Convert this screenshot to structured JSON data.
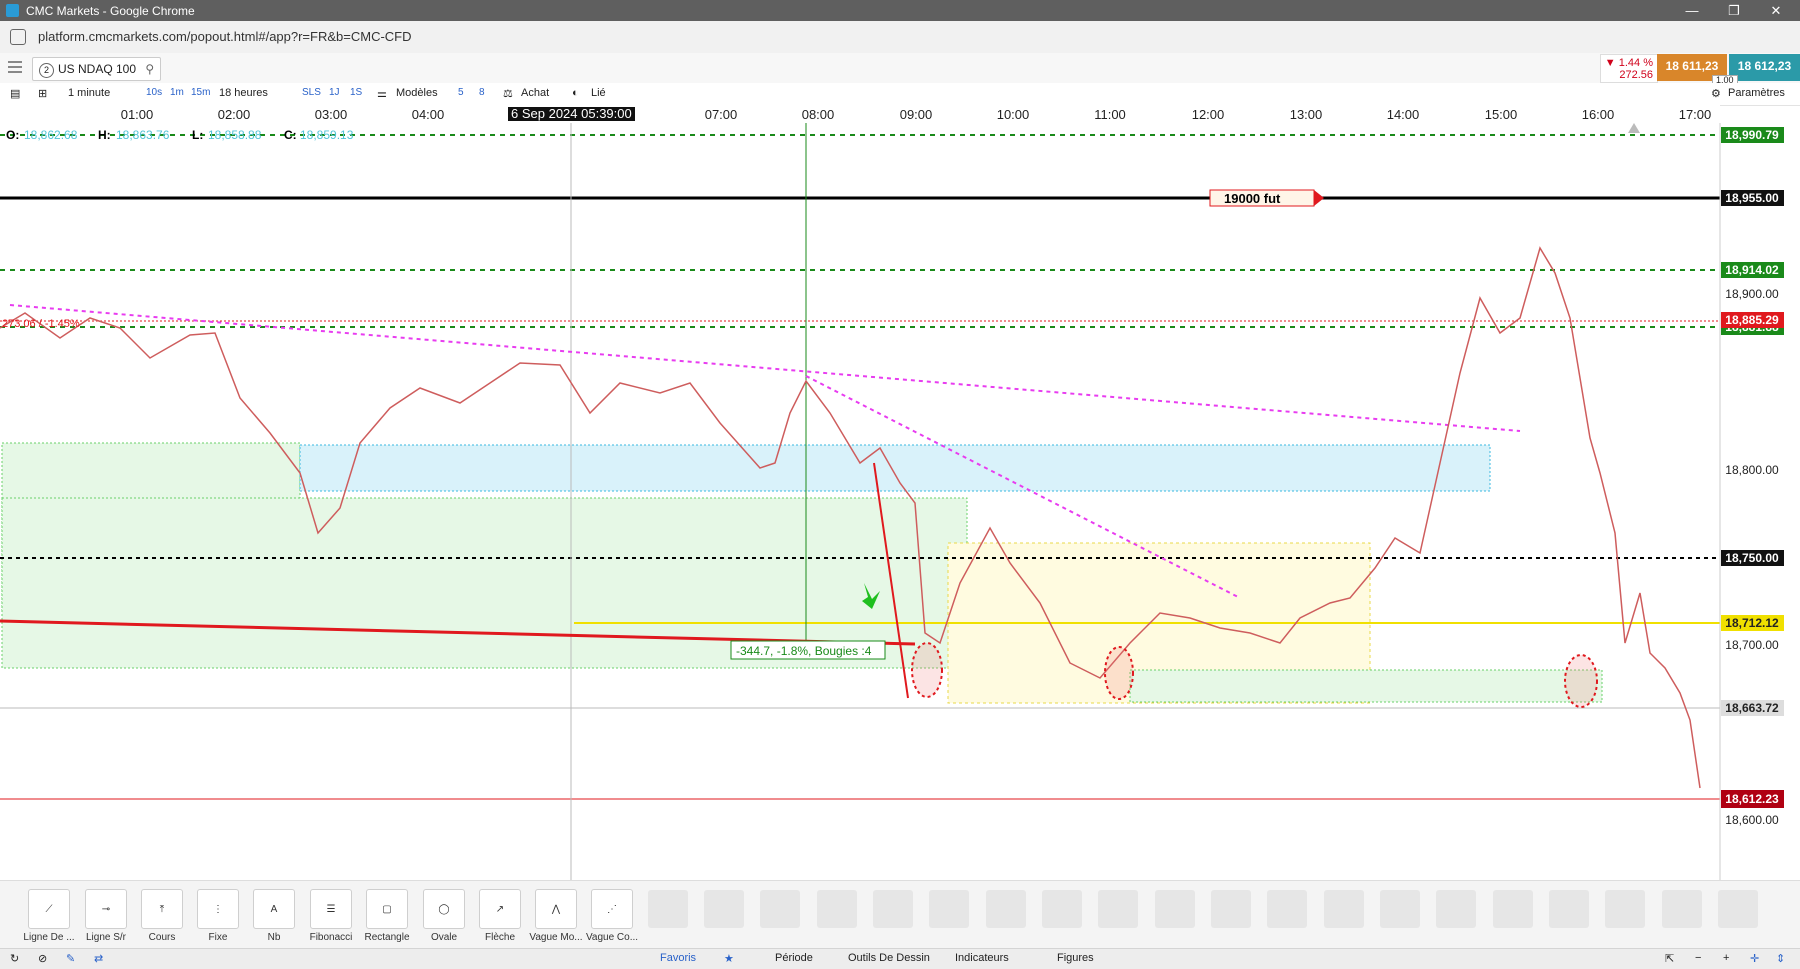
{
  "window": {
    "title": "CMC Markets - Google Chrome",
    "url": "platform.cmcmarkets.com/popout.html#/app?r=FR&b=CMC-CFD"
  },
  "instrument": {
    "index": "2",
    "name": "US NDAQ 100"
  },
  "quote": {
    "change_pct": "▼ 1.44 %",
    "change_pts": "272.56",
    "sell": "18 611,23",
    "buy": "18 612,23",
    "spread": "1.00"
  },
  "toolbar": {
    "interval": "1 minute",
    "timeframes": [
      "10s",
      "1m",
      "15m"
    ],
    "range": "18 heures",
    "sls": "SLS",
    "j1": "1J",
    "s1": "1S",
    "templates": "Modèles",
    "n5": "5",
    "n8": "8",
    "buy": "Achat",
    "linked": "Lié",
    "settings": "Paramètres"
  },
  "time_axis": {
    "ticks": [
      "01:00",
      "02:00",
      "03:00",
      "04:00",
      "07:00",
      "08:00",
      "09:00",
      "10:00",
      "11:00",
      "12:00",
      "13:00",
      "14:00",
      "15:00",
      "16:00",
      "17:00"
    ],
    "cursor_label": "6 Sep 2024 05:39:00"
  },
  "ohlc": {
    "o_label": "O:",
    "o": "18,862.68",
    "h_label": "H:",
    "h": "18,863.76",
    "l_label": "L:",
    "l": "18,858.88",
    "c_label": "C:",
    "c": "18,859.13"
  },
  "price_axis": {
    "ticks": [
      "18,900.00",
      "18,800.00",
      "18,700.00",
      "18,600.00"
    ],
    "tags": [
      {
        "label": "18,990.79",
        "kind": "green"
      },
      {
        "label": "18,955.00",
        "kind": "black"
      },
      {
        "label": "18,914.02",
        "kind": "green"
      },
      {
        "label": "18,885.29",
        "kind": "red"
      },
      {
        "label": "18,881.88",
        "kind": "green"
      },
      {
        "label": "18,750.00",
        "kind": "black"
      },
      {
        "label": "18,712.12",
        "kind": "yellow"
      },
      {
        "label": "18,663.72",
        "kind": "grey"
      },
      {
        "label": "18,612.23",
        "kind": "darkred"
      }
    ]
  },
  "annotations": {
    "fut_label": "19000   fut",
    "measure_label": "-344.7, -1.8%, Bougies :4",
    "left_label": "273.06 / -1.45%"
  },
  "colors": {
    "green_line": "#1a8a1a",
    "black_line": "#000000",
    "red_line": "#e0191e",
    "magenta": "#e83cf0",
    "yellow": "#f0e000",
    "accent_orange": "#d9862a",
    "accent_teal": "#2b9aa8"
  },
  "drawing_tools": [
    {
      "label": "Ligne De ...",
      "icon": "line-icon"
    },
    {
      "label": "Ligne S/r",
      "icon": "sr-line-icon"
    },
    {
      "label": "Cours",
      "icon": "price-icon"
    },
    {
      "label": "Fixe",
      "icon": "fixed-icon"
    },
    {
      "label": "Nb",
      "icon": "text-icon"
    },
    {
      "label": "Fibonacci",
      "icon": "fibonacci-icon"
    },
    {
      "label": "Rectangle",
      "icon": "rectangle-icon"
    },
    {
      "label": "Ovale",
      "icon": "oval-icon"
    },
    {
      "label": "Flèche",
      "icon": "arrow-icon"
    },
    {
      "label": "Vague Mo...",
      "icon": "wave-icon"
    },
    {
      "label": "Vague Co...",
      "icon": "wave2-icon"
    }
  ],
  "bottom_tabs": [
    "Favoris",
    "Période",
    "Outils De Dessin",
    "Indicateurs",
    "Figures"
  ]
}
